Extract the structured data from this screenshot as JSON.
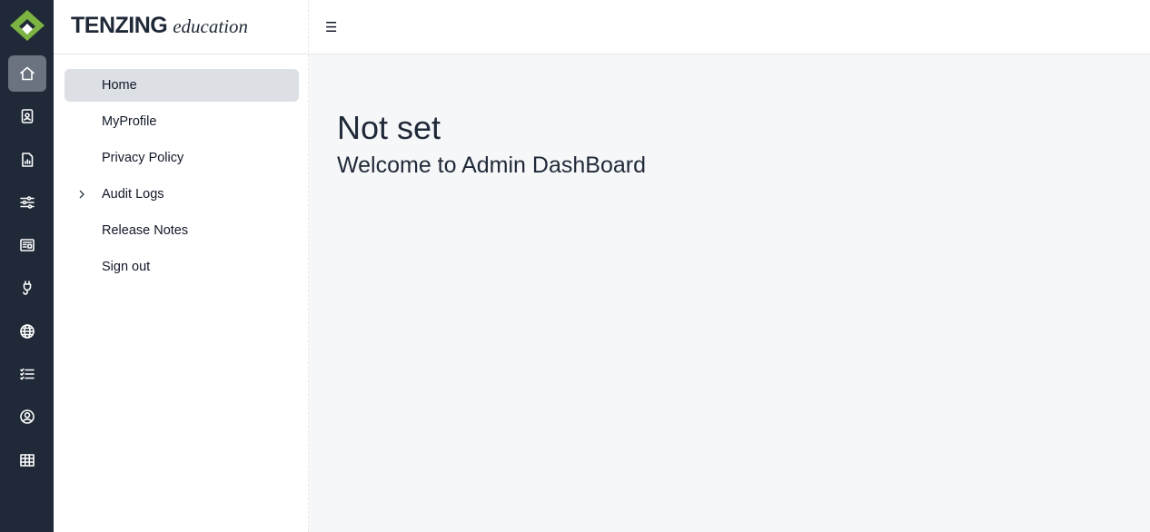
{
  "brand": {
    "name": "TENZING",
    "tagline": "education",
    "accent": "#7cb342"
  },
  "rail": {
    "items": [
      {
        "icon": "home-icon",
        "active": true
      },
      {
        "icon": "id-badge-icon",
        "active": false
      },
      {
        "icon": "report-icon",
        "active": false
      },
      {
        "icon": "sliders-icon",
        "active": false
      },
      {
        "icon": "newspaper-icon",
        "active": false
      },
      {
        "icon": "plug-icon",
        "active": false
      },
      {
        "icon": "globe-icon",
        "active": false
      },
      {
        "icon": "checklist-icon",
        "active": false
      },
      {
        "icon": "user-circle-icon",
        "active": false
      },
      {
        "icon": "table-icon",
        "active": false
      }
    ]
  },
  "sidebar": {
    "items": [
      {
        "label": "Home",
        "active": true
      },
      {
        "label": "MyProfile"
      },
      {
        "label": "Privacy Policy"
      },
      {
        "label": "Audit Logs",
        "expandable": true
      },
      {
        "label": "Release Notes"
      },
      {
        "label": "Sign out"
      }
    ]
  },
  "header": {
    "menu_icon": "hamburger-icon",
    "menu_glyph": "☰"
  },
  "main": {
    "title": "Not set",
    "subtitle": "Welcome to Admin DashBoard"
  },
  "colors": {
    "rail_bg": "#1f2937",
    "rail_active": "#6b7280",
    "nav_active": "#dcdfe4",
    "content_bg": "#f6f7f9"
  }
}
